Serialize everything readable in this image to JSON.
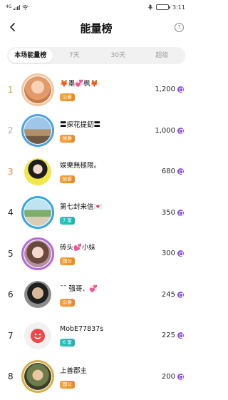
{
  "status": {
    "net": "4G",
    "time": "3:11",
    "battery": ""
  },
  "header": {
    "title": "能量榜",
    "help_icon": "help-circle-icon"
  },
  "tabs": [
    {
      "label": "本场能量榜",
      "active": true
    },
    {
      "label": "7天",
      "active": false
    },
    {
      "label": "30天",
      "active": false
    },
    {
      "label": "超级",
      "active": false
    }
  ],
  "colors": {
    "rank1": "#c9a63a",
    "rank2": "#a9b2c4",
    "rank3": "#e08a44",
    "rank_other": "#222222",
    "coin": "#8e4fe0"
  },
  "rows": [
    {
      "rank": "1",
      "name": "🦊墨💞枫🦊",
      "badge": "公爵",
      "badge_color": "orange",
      "score": "1,200"
    },
    {
      "rank": "2",
      "name": "〓探花提釖〓",
      "badge": "侯爵",
      "badge_color": "orange",
      "score": "1,000"
    },
    {
      "rank": "3",
      "name": "娱樂無極限。",
      "badge": "侯爵",
      "badge_color": "orange",
      "score": "680"
    },
    {
      "rank": "4",
      "name": "第七封来信💌",
      "badge": "7 富",
      "badge_color": "teal",
      "score": "350"
    },
    {
      "rank": "5",
      "name": "砖头💕小妹",
      "badge": "国公",
      "badge_color": "orange",
      "score": "300"
    },
    {
      "rank": "6",
      "name": "¯¯ 强哥、💞",
      "badge": "公爵",
      "badge_color": "orange",
      "score": "245"
    },
    {
      "rank": "7",
      "name": "MobE77837s",
      "badge": "6 富",
      "badge_color": "teal",
      "score": "225"
    },
    {
      "rank": "8",
      "name": "上善郡主",
      "badge": "国公",
      "badge_color": "orange",
      "score": "200"
    }
  ]
}
